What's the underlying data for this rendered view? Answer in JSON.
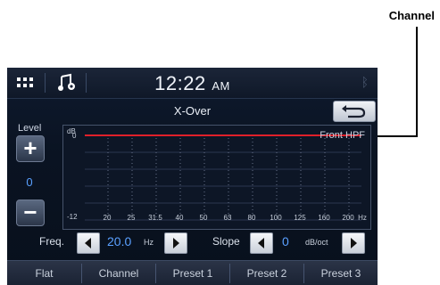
{
  "callout": {
    "label": "Channel"
  },
  "header": {
    "time": "12:22",
    "ampm": "AM"
  },
  "page": {
    "title": "X-Over"
  },
  "level": {
    "label": "Level",
    "value": "0"
  },
  "graph": {
    "channel_name": "Front HPF",
    "y_unit": "dB",
    "y_top": "0",
    "y_bottom": "-12",
    "x_labels": [
      "20",
      "25",
      "31.5",
      "40",
      "50",
      "63",
      "80",
      "100",
      "125",
      "160",
      "200"
    ],
    "x_unit": "Hz",
    "line_color": "#e0202a"
  },
  "freq": {
    "label": "Freq.",
    "value": "20.0",
    "unit": "Hz"
  },
  "slope": {
    "label": "Slope",
    "value": "0",
    "unit": "dB/oct"
  },
  "tabs": [
    "Flat",
    "Channel",
    "Preset 1",
    "Preset 2",
    "Preset 3"
  ],
  "colors": {
    "accent": "#5aa0ff"
  }
}
